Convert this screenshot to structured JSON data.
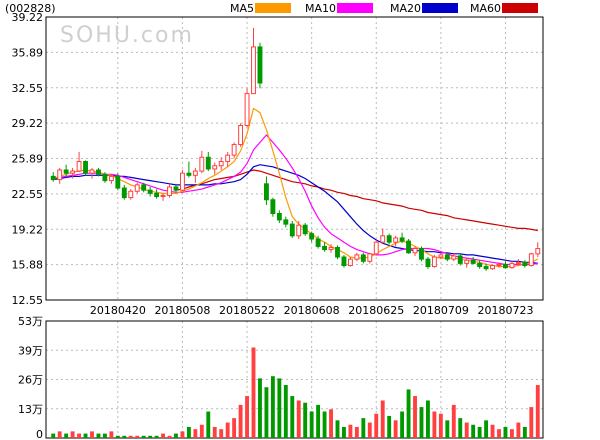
{
  "stock_code": "(002828)",
  "watermark": "SOHU.com",
  "colors": {
    "up": "#ff4040",
    "down": "#009900",
    "ma5": "#ff9900",
    "ma10": "#ff00ff",
    "ma20": "#0000cc",
    "ma60": "#cc0000",
    "grid": "#bbbbbb"
  },
  "legend": [
    {
      "label": "MA5",
      "color": "#ff9900"
    },
    {
      "label": "MA10",
      "color": "#ff00ff"
    },
    {
      "label": "MA20",
      "color": "#0000cc"
    },
    {
      "label": "MA60",
      "color": "#cc0000"
    }
  ],
  "chart_data": [
    {
      "type": "candlestick",
      "y_ticks": [
        "39.22",
        "35.89",
        "32.55",
        "29.22",
        "25.89",
        "22.55",
        "19.22",
        "15.88",
        "12.55"
      ],
      "ylim": [
        12.55,
        39.22
      ],
      "x_ticks": [
        {
          "index": 10,
          "label": "20180420"
        },
        {
          "index": 20,
          "label": "20180508"
        },
        {
          "index": 30,
          "label": "20180522"
        },
        {
          "index": 40,
          "label": "20180608"
        },
        {
          "index": 50,
          "label": "20180625"
        },
        {
          "index": 60,
          "label": "20180709"
        },
        {
          "index": 70,
          "label": "20180723"
        }
      ],
      "ohlc": [
        [
          24.2,
          24.6,
          23.7,
          23.9
        ],
        [
          23.9,
          25.0,
          23.5,
          24.8
        ],
        [
          24.8,
          25.3,
          24.2,
          24.5
        ],
        [
          24.5,
          25.0,
          24.0,
          24.7
        ],
        [
          24.7,
          26.5,
          24.6,
          25.6
        ],
        [
          25.6,
          25.7,
          24.3,
          24.5
        ],
        [
          24.5,
          25.0,
          24.0,
          24.8
        ],
        [
          24.8,
          25.0,
          24.2,
          24.4
        ],
        [
          24.4,
          24.6,
          23.6,
          23.8
        ],
        [
          23.8,
          24.4,
          23.5,
          24.2
        ],
        [
          24.2,
          24.5,
          22.9,
          23.1
        ],
        [
          23.1,
          23.4,
          22.0,
          22.2
        ],
        [
          22.2,
          23.0,
          22.0,
          22.8
        ],
        [
          22.8,
          23.6,
          22.6,
          23.4
        ],
        [
          23.4,
          23.6,
          22.7,
          22.9
        ],
        [
          22.9,
          23.2,
          22.3,
          22.6
        ],
        [
          22.6,
          23.0,
          22.1,
          22.3
        ],
        [
          22.3,
          22.6,
          21.9,
          22.4
        ],
        [
          22.4,
          23.5,
          22.2,
          23.2
        ],
        [
          23.2,
          23.5,
          22.7,
          22.9
        ],
        [
          22.9,
          24.8,
          22.8,
          24.5
        ],
        [
          24.5,
          25.6,
          24.1,
          24.3
        ],
        [
          24.3,
          25.0,
          23.6,
          24.7
        ],
        [
          24.7,
          26.6,
          24.5,
          26.0
        ],
        [
          26.0,
          26.5,
          24.7,
          24.9
        ],
        [
          24.9,
          25.5,
          24.4,
          25.2
        ],
        [
          25.2,
          26.0,
          24.8,
          25.6
        ],
        [
          25.6,
          26.5,
          25.1,
          26.2
        ],
        [
          26.2,
          27.4,
          25.9,
          27.2
        ],
        [
          27.2,
          29.2,
          27.0,
          29.0
        ],
        [
          29.0,
          32.5,
          28.8,
          32.0
        ],
        [
          32.0,
          38.2,
          32.0,
          36.4
        ],
        [
          36.4,
          36.8,
          32.5,
          33.0
        ],
        [
          23.5,
          24.2,
          21.5,
          22.0
        ],
        [
          22.0,
          22.2,
          20.4,
          20.7
        ],
        [
          20.7,
          21.0,
          19.8,
          20.1
        ],
        [
          20.1,
          20.4,
          19.4,
          19.7
        ],
        [
          19.7,
          20.0,
          18.4,
          18.6
        ],
        [
          18.6,
          20.0,
          18.3,
          19.6
        ],
        [
          19.6,
          19.8,
          18.6,
          18.8
        ],
        [
          18.8,
          19.0,
          18.0,
          18.3
        ],
        [
          18.3,
          18.6,
          17.4,
          17.6
        ],
        [
          17.6,
          18.0,
          17.1,
          17.3
        ],
        [
          17.3,
          17.8,
          17.0,
          17.5
        ],
        [
          17.5,
          17.7,
          16.4,
          16.6
        ],
        [
          16.6,
          16.8,
          15.6,
          15.8
        ],
        [
          15.8,
          16.6,
          15.7,
          16.4
        ],
        [
          16.4,
          17.0,
          16.2,
          16.8
        ],
        [
          16.8,
          17.0,
          16.0,
          16.2
        ],
        [
          16.2,
          17.0,
          16.0,
          16.9
        ],
        [
          16.9,
          18.2,
          16.8,
          18.0
        ],
        [
          18.0,
          19.3,
          17.9,
          18.6
        ],
        [
          18.6,
          18.8,
          17.8,
          18.0
        ],
        [
          18.0,
          18.6,
          17.6,
          18.4
        ],
        [
          18.4,
          18.9,
          17.9,
          18.1
        ],
        [
          18.1,
          18.3,
          16.9,
          17.0
        ],
        [
          17.0,
          17.6,
          16.7,
          17.4
        ],
        [
          17.4,
          17.6,
          16.2,
          16.4
        ],
        [
          16.4,
          16.6,
          15.5,
          15.7
        ],
        [
          15.7,
          16.8,
          15.6,
          16.6
        ],
        [
          16.6,
          17.0,
          16.4,
          16.8
        ],
        [
          16.8,
          17.0,
          16.2,
          16.4
        ],
        [
          16.4,
          16.9,
          16.2,
          16.7
        ],
        [
          16.7,
          16.9,
          15.8,
          16.0
        ],
        [
          16.0,
          16.5,
          15.6,
          16.3
        ],
        [
          16.3,
          16.6,
          15.9,
          16.0
        ],
        [
          16.0,
          16.3,
          15.5,
          15.7
        ],
        [
          15.7,
          16.0,
          15.3,
          15.5
        ],
        [
          15.5,
          15.9,
          15.4,
          15.8
        ],
        [
          15.8,
          16.1,
          15.6,
          15.9
        ],
        [
          15.9,
          16.2,
          15.5,
          15.6
        ],
        [
          15.6,
          16.2,
          15.5,
          16.0
        ],
        [
          16.0,
          16.4,
          15.8,
          16.1
        ],
        [
          16.1,
          16.3,
          15.6,
          15.8
        ],
        [
          15.8,
          17.0,
          15.7,
          16.9
        ],
        [
          16.9,
          18.0,
          16.6,
          17.4
        ]
      ],
      "ma5": [
        24.0,
        24.2,
        24.4,
        24.6,
        24.7,
        24.8,
        24.7,
        24.6,
        24.4,
        24.3,
        24.0,
        23.7,
        23.4,
        23.2,
        23.0,
        22.8,
        22.7,
        22.6,
        22.6,
        22.6,
        22.8,
        23.0,
        23.3,
        23.6,
        24.0,
        24.3,
        24.7,
        25.1,
        25.6,
        26.6,
        28.2,
        30.6,
        30.2,
        28.6,
        26.6,
        24.5,
        22.2,
        20.4,
        19.7,
        19.2,
        18.8,
        18.3,
        18.0,
        17.6,
        17.3,
        17.0,
        16.6,
        16.5,
        16.5,
        16.6,
        16.9,
        17.3,
        17.6,
        17.9,
        18.1,
        17.9,
        17.6,
        17.3,
        16.9,
        16.6,
        16.5,
        16.5,
        16.5,
        16.4,
        16.3,
        16.2,
        16.1,
        15.9,
        15.8,
        15.7,
        15.7,
        15.7,
        15.8,
        15.9,
        16.1,
        16.4
      ],
      "ma10": [
        24.0,
        24.1,
        24.2,
        24.3,
        24.4,
        24.5,
        24.5,
        24.5,
        24.4,
        24.4,
        24.3,
        24.1,
        23.9,
        23.7,
        23.5,
        23.3,
        23.1,
        22.9,
        22.8,
        22.7,
        22.7,
        22.8,
        22.9,
        23.0,
        23.2,
        23.4,
        23.6,
        23.9,
        24.2,
        24.6,
        25.4,
        26.7,
        27.4,
        28.1,
        27.4,
        26.7,
        25.9,
        25.0,
        24.0,
        22.8,
        21.4,
        20.3,
        19.4,
        18.8,
        18.4,
        18.0,
        17.6,
        17.3,
        17.1,
        16.9,
        16.8,
        16.8,
        16.9,
        17.1,
        17.3,
        17.4,
        17.4,
        17.4,
        17.4,
        17.3,
        17.1,
        16.9,
        16.7,
        16.6,
        16.5,
        16.4,
        16.3,
        16.2,
        16.1,
        16.0,
        15.9,
        15.9,
        15.9,
        15.9,
        15.9,
        16.0
      ],
      "ma20": [
        23.9,
        24.0,
        24.1,
        24.2,
        24.2,
        24.3,
        24.3,
        24.3,
        24.3,
        24.3,
        24.2,
        24.2,
        24.1,
        24.0,
        23.9,
        23.8,
        23.7,
        23.6,
        23.5,
        23.4,
        23.4,
        23.4,
        23.4,
        23.4,
        23.4,
        23.5,
        23.5,
        23.6,
        23.7,
        23.9,
        24.4,
        25.1,
        25.3,
        25.2,
        25.1,
        24.9,
        24.7,
        24.5,
        24.3,
        24.0,
        23.6,
        23.2,
        22.8,
        22.3,
        21.8,
        21.1,
        20.4,
        19.7,
        19.1,
        18.6,
        18.2,
        17.9,
        17.7,
        17.5,
        17.4,
        17.3,
        17.2,
        17.2,
        17.1,
        17.1,
        17.0,
        17.0,
        16.9,
        16.9,
        16.8,
        16.8,
        16.7,
        16.6,
        16.5,
        16.4,
        16.3,
        16.2,
        16.2,
        16.1,
        16.1,
        16.0
      ],
      "ma60": [
        null,
        null,
        null,
        null,
        null,
        null,
        null,
        null,
        null,
        null,
        null,
        null,
        null,
        null,
        null,
        null,
        null,
        null,
        null,
        22.9,
        23.0,
        23.2,
        23.4,
        23.5,
        23.7,
        23.9,
        24.0,
        24.1,
        24.2,
        24.4,
        24.6,
        24.8,
        24.7,
        24.5,
        24.3,
        24.1,
        23.9,
        23.7,
        23.6,
        23.5,
        23.3,
        23.2,
        23.0,
        22.9,
        22.7,
        22.6,
        22.4,
        22.3,
        22.1,
        22.0,
        21.9,
        21.7,
        21.6,
        21.5,
        21.4,
        21.2,
        21.1,
        21.0,
        20.8,
        20.7,
        20.6,
        20.5,
        20.3,
        20.2,
        20.1,
        20.0,
        19.9,
        19.8,
        19.7,
        19.6,
        19.5,
        19.4,
        19.3,
        19.3,
        19.2,
        19.1
      ]
    },
    {
      "type": "bar",
      "y_ticks": [
        "53万",
        "39万",
        "26万",
        "13万",
        "0"
      ],
      "ylim": [
        0,
        53
      ],
      "volume": [
        2,
        3,
        2,
        3,
        2,
        2,
        3,
        2,
        2,
        3,
        1,
        1,
        1,
        1,
        1,
        1,
        1,
        2,
        1,
        2,
        3,
        5,
        4,
        6,
        12,
        5,
        4,
        7,
        9,
        15,
        19,
        41,
        27,
        23,
        28,
        27,
        24,
        19,
        17,
        16,
        12,
        15,
        12,
        13,
        8,
        5,
        6,
        5,
        9,
        7,
        11,
        17,
        10,
        8,
        12,
        22,
        19,
        14,
        17,
        12,
        11,
        8,
        15,
        9,
        7,
        6,
        5,
        8,
        6,
        4,
        5,
        4,
        7,
        5,
        14,
        24
      ]
    }
  ]
}
